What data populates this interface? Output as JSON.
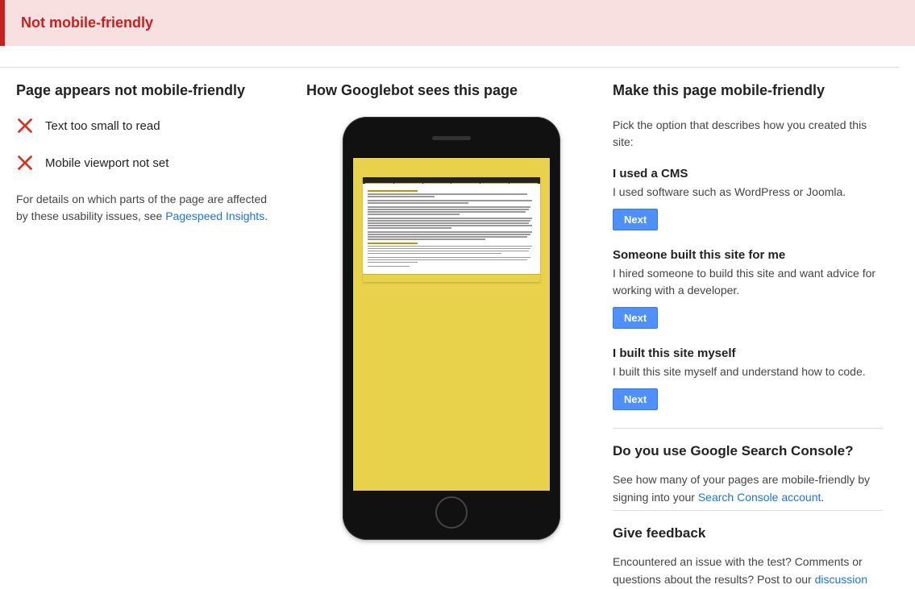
{
  "banner": {
    "text": "Not mobile-friendly"
  },
  "col_left": {
    "heading": "Page appears not mobile-friendly",
    "issues": [
      "Text too small to read",
      "Mobile viewport not set"
    ],
    "details_prefix": "For details on which parts of the page are affected by these usability issues, see ",
    "details_link": "Pagespeed Insights",
    "details_suffix": "."
  },
  "col_mid": {
    "heading": "How Googlebot sees this page"
  },
  "col_right": {
    "heading": "Make this page mobile-friendly",
    "intro": "Pick the option that describes how you created this site:",
    "options": [
      {
        "title": "I used a CMS",
        "desc": "I used software such as WordPress or Joomla.",
        "next": "Next"
      },
      {
        "title": "Someone built this site for me",
        "desc": "I hired someone to build this site and want advice for working with a developer.",
        "next": "Next"
      },
      {
        "title": "I built this site myself",
        "desc": "I built this site myself and understand how to code.",
        "next": "Next"
      }
    ],
    "search_console": {
      "heading": "Do you use Google Search Console?",
      "text_prefix": "See how many of your pages are mobile-friendly by signing into your ",
      "link": "Search Console account",
      "text_suffix": "."
    },
    "feedback": {
      "heading": "Give feedback",
      "text_prefix": "Encountered an issue with the test? Comments or questions about the results? Post to our ",
      "link": "discussion"
    }
  }
}
